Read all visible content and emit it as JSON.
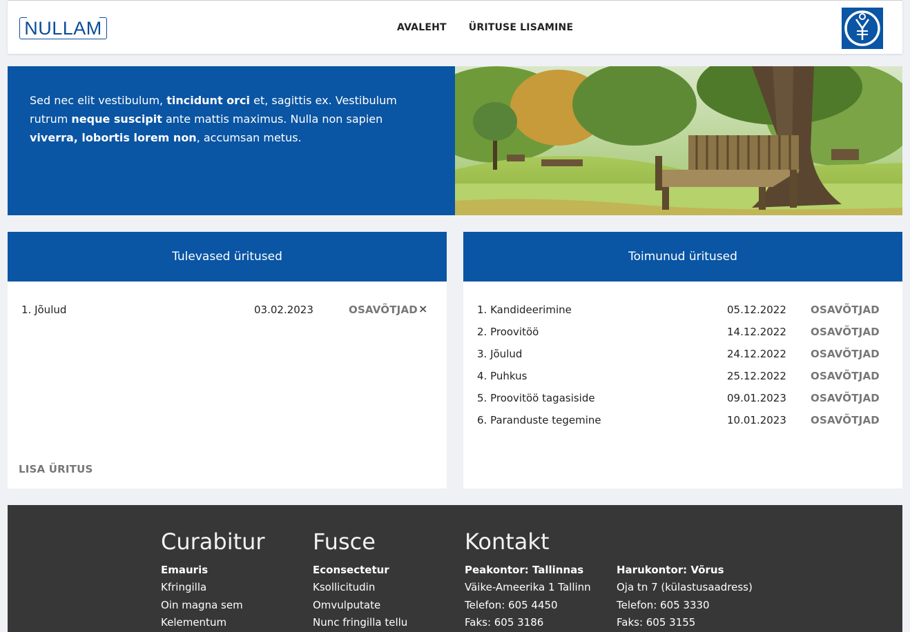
{
  "header": {
    "logo_text": "NULLAM",
    "nav": [
      "AVALEHT",
      "ÜRITUSE LISAMINE"
    ]
  },
  "hero": {
    "segments": [
      {
        "text": "Sed nec elit vestibulum, ",
        "bold": false
      },
      {
        "text": "tincidunt orci",
        "bold": true
      },
      {
        "text": " et, sagittis ex. Vestibulum rutrum ",
        "bold": false
      },
      {
        "text": "neque suscipit",
        "bold": true
      },
      {
        "text": " ante mattis maximus. Nulla non sapien ",
        "bold": false
      },
      {
        "text": "viverra, lobortis lorem non",
        "bold": true
      },
      {
        "text": ", accumsan metus.",
        "bold": false
      }
    ]
  },
  "upcoming": {
    "title": "Tulevased üritused",
    "rows": [
      {
        "name": "1. Jõulud",
        "date": "03.02.2023",
        "action": "OSAVÕTJAD",
        "delete": "×"
      }
    ],
    "add_label": "LISA ÜRITUS"
  },
  "past": {
    "title": "Toimunud üritused",
    "rows": [
      {
        "name": "1. Kandideerimine",
        "date": "05.12.2022",
        "action": "OSAVÕTJAD"
      },
      {
        "name": "2. Proovitöö",
        "date": "14.12.2022",
        "action": "OSAVÕTJAD"
      },
      {
        "name": "3. Jõulud",
        "date": "24.12.2022",
        "action": "OSAVÕTJAD"
      },
      {
        "name": "4. Puhkus",
        "date": "25.12.2022",
        "action": "OSAVÕTJAD"
      },
      {
        "name": "5. Proovitöö tagasiside",
        "date": "09.01.2023",
        "action": "OSAVÕTJAD"
      },
      {
        "name": "6. Paranduste tegemine",
        "date": "10.01.2023",
        "action": "OSAVÕTJAD"
      }
    ]
  },
  "footer": {
    "columns": [
      {
        "title": "Curabitur",
        "strong": "Emauris",
        "lines": [
          "Kfringilla",
          "Oin magna sem",
          "Kelementum"
        ]
      },
      {
        "title": "Fusce",
        "strong": "Econsectetur",
        "lines": [
          "Ksollicitudin",
          "Omvulputate",
          "Nunc fringilla tellu"
        ]
      },
      {
        "title": "Kontakt",
        "strong": "Peakontor: Tallinnas",
        "lines": [
          "Väike-Ameerika 1 Tallinn",
          "Telefon: 605 4450",
          "Faks: 605 3186"
        ]
      },
      {
        "title": "",
        "strong": "Harukontor: Võrus",
        "lines": [
          "Oja tn 7 (külastusaadress)",
          "Telefon: 605 3330",
          "Faks: 605 3155"
        ]
      }
    ]
  },
  "colors": {
    "brand_blue": "#0a55a4",
    "footer_bg": "#373737",
    "page_bg": "#f0f1f5",
    "action_gray": "#777777"
  },
  "icons": {
    "emblem": "yen-emblem-icon",
    "delete": "close-icon"
  }
}
